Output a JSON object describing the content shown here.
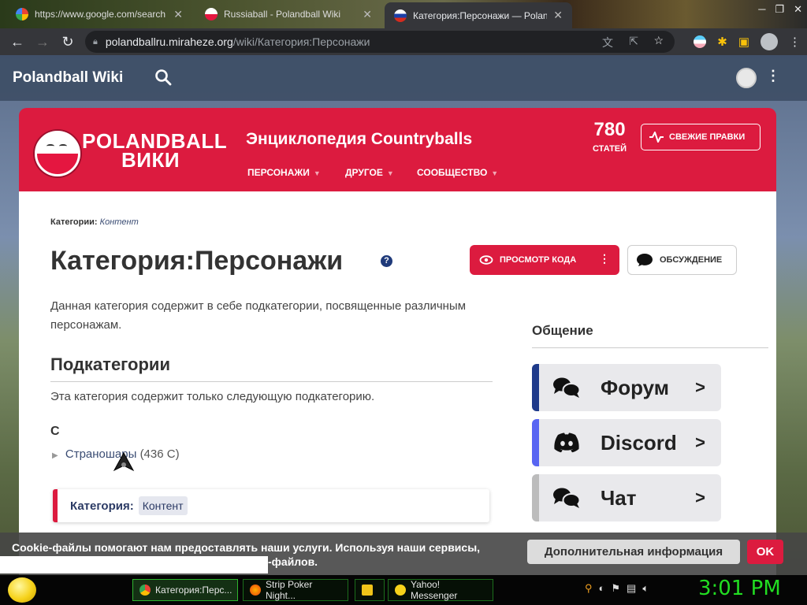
{
  "browser": {
    "tabs": [
      {
        "title": "https://www.google.com/search",
        "icon": "google-icon"
      },
      {
        "title": "Russiaball - Polandball Wiki",
        "icon": "polandball-icon"
      },
      {
        "title": "Категория:Персонажи — Polandball Wiki",
        "icon": "russiaball-icon",
        "active": true
      }
    ],
    "address": {
      "host": "polandballru.miraheze.org",
      "path": "/wiki/Категория:Персонажи"
    }
  },
  "site": {
    "name": "Polandball Wiki",
    "logo_line1": "POLANDBALL",
    "logo_line2": "ВИКИ",
    "tagline": "Энциклопедия Countryballs",
    "nav": [
      "ПЕРСОНАЖИ",
      "ДРУГОЕ",
      "СООБЩЕСТВО"
    ],
    "article_count": "780",
    "article_count_label": "СТАТЕЙ",
    "recent_changes": "СВЕЖИЕ ПРАВКИ",
    "brand_color": "#dc1b3f"
  },
  "article": {
    "breadcrumb_label": "Категории:",
    "breadcrumb_link": "Контент",
    "title": "Категория:Персонажи",
    "view_source": "ПРОСМОТР КОДА",
    "discussion": "ОБСУЖДЕНИЕ",
    "description": "Данная категория содержит в себе подкатегории, посвященные различным персонажам.",
    "subcategories_heading": "Подкатегории",
    "subcategories_note": "Эта категория содержит только следующую подкатегорию.",
    "letter": "С",
    "subcategory": {
      "name": "Страношары",
      "count": "(436 С)"
    },
    "category_label": "Категория:",
    "category_tag": "Контент"
  },
  "sidebar": {
    "heading": "Общение",
    "links": [
      {
        "label": "Форум",
        "icon": "forum-icon",
        "color": "#1f3a8a"
      },
      {
        "label": "Discord",
        "icon": "discord-icon",
        "color": "#5865f2"
      },
      {
        "label": "Чат",
        "icon": "chat-icon",
        "color": "#bcbcbc"
      }
    ]
  },
  "cookie": {
    "message_line1": "Cookie-файлы помогают нам предоставлять наши услуги. Используя наши сервисы,",
    "message_line2": "-файлов.",
    "more_info": "Дополнительная информация",
    "ok": "OK"
  },
  "taskbar": {
    "items": [
      {
        "label": "Категория:Перс...",
        "icon": "chrome-icon",
        "active": true
      },
      {
        "label": "Strip Poker Night...",
        "icon": "firefox-icon"
      },
      {
        "label": "",
        "icon": "folder-icon"
      },
      {
        "label": "Yahoo! Messenger",
        "icon": "yahoo-messenger-icon"
      }
    ],
    "clock": "3:01 PM"
  }
}
